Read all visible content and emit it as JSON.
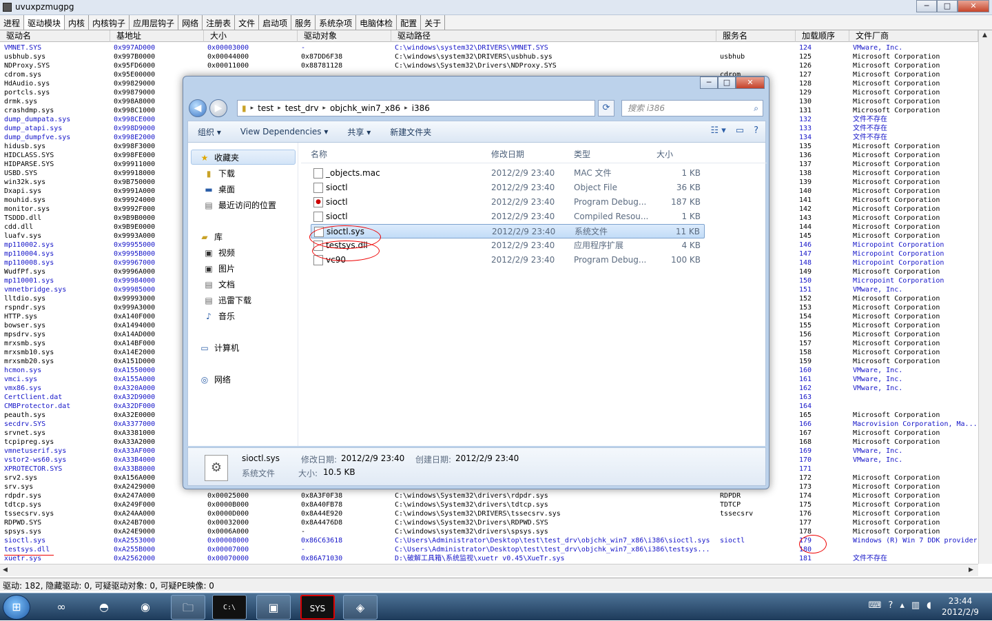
{
  "app": {
    "title": "uvuxpzmugpg",
    "controls": [
      "─",
      "□",
      "✕"
    ]
  },
  "tabs": [
    "进程",
    "驱动模块",
    "内核",
    "内核钩子",
    "应用层钩子",
    "网络",
    "注册表",
    "文件",
    "启动项",
    "服务",
    "系统杂项",
    "电脑体检",
    "配置",
    "关于"
  ],
  "table": {
    "columns": [
      "驱动名",
      "基地址",
      "大小",
      "驱动对象",
      "驱动路径",
      "服务名",
      "加载顺序",
      "文件厂商"
    ],
    "rows": [
      {
        "c": [
          "VMNET.SYS",
          "0x997AD000",
          "0x00003000",
          "-",
          "C:\\windows\\system32\\DRIVERS\\VMNET.SYS",
          "",
          "124",
          "VMware, Inc."
        ],
        "blue": true
      },
      {
        "c": [
          "usbhub.sys",
          "0x997B0000",
          "0x00044000",
          "0x87DD6F38",
          "C:\\windows\\system32\\DRIVERS\\usbhub.sys",
          "usbhub",
          "125",
          "Microsoft Corporation"
        ]
      },
      {
        "c": [
          "NDProxy.SYS",
          "0x95FD6000",
          "0x00011000",
          "0x88781128",
          "C:\\windows\\System32\\Drivers\\NDProxy.SYS",
          "",
          "126",
          "Microsoft Corporation"
        ]
      },
      {
        "c": [
          "cdrom.sys",
          "0x95E00000",
          "",
          "",
          "",
          "cdrom",
          "127",
          "Microsoft Corporation"
        ]
      },
      {
        "c": [
          "HdAudio.sys",
          "0x99829000",
          "",
          "",
          "",
          "",
          "128",
          "Microsoft Corporation"
        ]
      },
      {
        "c": [
          "portcls.sys",
          "0x99879000",
          "",
          "",
          "",
          "",
          "129",
          "Microsoft Corporation"
        ]
      },
      {
        "c": [
          "drmk.sys",
          "0x998A8000",
          "",
          "",
          "",
          "",
          "130",
          "Microsoft Corporation"
        ]
      },
      {
        "c": [
          "crashdmp.sys",
          "0x998C1000",
          "",
          "",
          "",
          "",
          "131",
          "Microsoft Corporation"
        ]
      },
      {
        "c": [
          "dump_dumpata.sys",
          "0x998CE000",
          "",
          "",
          "",
          "",
          "132",
          "文件不存在"
        ],
        "blue": true
      },
      {
        "c": [
          "dump_atapi.sys",
          "0x998D9000",
          "",
          "",
          "",
          "",
          "133",
          "文件不存在"
        ],
        "blue": true
      },
      {
        "c": [
          "dump_dumpfve.sys",
          "0x998E2000",
          "",
          "",
          "",
          "",
          "134",
          "文件不存在"
        ],
        "blue": true
      },
      {
        "c": [
          "hidusb.sys",
          "0x998F3000",
          "",
          "",
          "",
          "",
          "135",
          "Microsoft Corporation"
        ]
      },
      {
        "c": [
          "HIDCLASS.SYS",
          "0x998FE000",
          "",
          "",
          "",
          "",
          "136",
          "Microsoft Corporation"
        ]
      },
      {
        "c": [
          "HIDPARSE.SYS",
          "0x99911000",
          "",
          "",
          "",
          "",
          "137",
          "Microsoft Corporation"
        ]
      },
      {
        "c": [
          "USBD.SYS",
          "0x99918000",
          "",
          "",
          "",
          "",
          "138",
          "Microsoft Corporation"
        ]
      },
      {
        "c": [
          "win32k.sys",
          "0x9B750000",
          "",
          "",
          "",
          "",
          "139",
          "Microsoft Corporation"
        ]
      },
      {
        "c": [
          "Dxapi.sys",
          "0x9991A000",
          "",
          "",
          "",
          "",
          "140",
          "Microsoft Corporation"
        ]
      },
      {
        "c": [
          "mouhid.sys",
          "0x99924000",
          "",
          "",
          "",
          "",
          "141",
          "Microsoft Corporation"
        ]
      },
      {
        "c": [
          "monitor.sys",
          "0x9992F000",
          "",
          "",
          "",
          "",
          "142",
          "Microsoft Corporation"
        ]
      },
      {
        "c": [
          "TSDDD.dll",
          "0x9B9B0000",
          "",
          "",
          "",
          "",
          "143",
          "Microsoft Corporation"
        ]
      },
      {
        "c": [
          "cdd.dll",
          "0x9B9E0000",
          "",
          "",
          "",
          "",
          "144",
          "Microsoft Corporation"
        ]
      },
      {
        "c": [
          "luafv.sys",
          "0x9993A000",
          "",
          "",
          "",
          "",
          "145",
          "Microsoft Corporation"
        ]
      },
      {
        "c": [
          "mp110002.sys",
          "0x99955000",
          "",
          "",
          "",
          "",
          "146",
          "Micropoint Corporation"
        ],
        "blue": true
      },
      {
        "c": [
          "mp110004.sys",
          "0x9995B000",
          "",
          "",
          "",
          "",
          "147",
          "Micropoint Corporation"
        ],
        "blue": true
      },
      {
        "c": [
          "mp110008.sys",
          "0x99967000",
          "",
          "",
          "",
          "",
          "148",
          "Micropoint Corporation"
        ],
        "blue": true
      },
      {
        "c": [
          "WudfPf.sys",
          "0x9996A000",
          "",
          "",
          "",
          "",
          "149",
          "Microsoft Corporation"
        ]
      },
      {
        "c": [
          "mp110001.sys",
          "0x99984000",
          "",
          "",
          "",
          "",
          "150",
          "Micropoint Corporation"
        ],
        "blue": true
      },
      {
        "c": [
          "vmnetbridge.sys",
          "0x99985000",
          "",
          "",
          "",
          "",
          "151",
          "VMware, Inc."
        ],
        "blue": true
      },
      {
        "c": [
          "lltdio.sys",
          "0x99993000",
          "",
          "",
          "",
          "",
          "152",
          "Microsoft Corporation"
        ]
      },
      {
        "c": [
          "rspndr.sys",
          "0x999A3000",
          "",
          "",
          "",
          "",
          "153",
          "Microsoft Corporation"
        ]
      },
      {
        "c": [
          "HTTP.sys",
          "0xA140F000",
          "",
          "",
          "",
          "",
          "154",
          "Microsoft Corporation"
        ]
      },
      {
        "c": [
          "bowser.sys",
          "0xA1494000",
          "",
          "",
          "",
          "",
          "155",
          "Microsoft Corporation"
        ]
      },
      {
        "c": [
          "mpsdrv.sys",
          "0xA14AD000",
          "",
          "",
          "",
          "",
          "156",
          "Microsoft Corporation"
        ]
      },
      {
        "c": [
          "mrxsmb.sys",
          "0xA14BF000",
          "",
          "",
          "",
          "",
          "157",
          "Microsoft Corporation"
        ]
      },
      {
        "c": [
          "mrxsmb10.sys",
          "0xA14E2000",
          "",
          "",
          "",
          "",
          "158",
          "Microsoft Corporation"
        ]
      },
      {
        "c": [
          "mrxsmb20.sys",
          "0xA151D000",
          "",
          "",
          "",
          "",
          "159",
          "Microsoft Corporation"
        ]
      },
      {
        "c": [
          "hcmon.sys",
          "0xA1550000",
          "",
          "",
          "",
          "",
          "160",
          "VMware, Inc."
        ],
        "blue": true
      },
      {
        "c": [
          "vmci.sys",
          "0xA155A000",
          "",
          "",
          "",
          "",
          "161",
          "VMware, Inc."
        ],
        "blue": true
      },
      {
        "c": [
          "vmx86.sys",
          "0xA320A000",
          "",
          "",
          "",
          "",
          "162",
          "VMware, Inc."
        ],
        "blue": true
      },
      {
        "c": [
          "CertClient.dat",
          "0xA32D9000",
          "",
          "",
          "",
          "",
          "163",
          ""
        ],
        "blue": true
      },
      {
        "c": [
          "CMBProtector.dat",
          "0xA32DF000",
          "",
          "",
          "",
          "",
          "164",
          ""
        ],
        "blue": true
      },
      {
        "c": [
          "peauth.sys",
          "0xA32E0000",
          "",
          "",
          "",
          "",
          "165",
          "Microsoft Corporation"
        ]
      },
      {
        "c": [
          "secdrv.SYS",
          "0xA3377000",
          "",
          "",
          "",
          "",
          "166",
          "Macrovision Corporation, Ma..."
        ],
        "blue": true
      },
      {
        "c": [
          "srvnet.sys",
          "0xA3381000",
          "",
          "",
          "",
          "",
          "167",
          "Microsoft Corporation"
        ]
      },
      {
        "c": [
          "tcpipreg.sys",
          "0xA33A2000",
          "",
          "",
          "",
          "",
          "168",
          "Microsoft Corporation"
        ]
      },
      {
        "c": [
          "vmnetuserif.sys",
          "0xA33AF000",
          "",
          "",
          "",
          "",
          "169",
          "VMware, Inc."
        ],
        "blue": true
      },
      {
        "c": [
          "vstor2-ws60.sys",
          "0xA33B4000",
          "",
          "",
          "",
          "",
          "170",
          "VMware, Inc."
        ],
        "blue": true
      },
      {
        "c": [
          "XPROTECTOR.SYS",
          "0xA33B8000",
          "",
          "",
          "",
          "",
          "171",
          ""
        ],
        "blue": true
      },
      {
        "c": [
          "srv2.sys",
          "0xA156A000",
          "",
          "",
          "",
          "",
          "172",
          "Microsoft Corporation"
        ]
      },
      {
        "c": [
          "srv.sys",
          "0xA2429000",
          "",
          "",
          "",
          "",
          "173",
          "Microsoft Corporation"
        ]
      },
      {
        "c": [
          "rdpdr.sys",
          "0xA247A000",
          "0x00025000",
          "0x8A3F0F38",
          "C:\\windows\\System32\\drivers\\rdpdr.sys",
          "RDPDR",
          "174",
          "Microsoft Corporation"
        ]
      },
      {
        "c": [
          "tdtcp.sys",
          "0xA249F000",
          "0x0000B000",
          "0x8A40FB78",
          "C:\\windows\\System32\\drivers\\tdtcp.sys",
          "TDTCP",
          "175",
          "Microsoft Corporation"
        ]
      },
      {
        "c": [
          "tssecsrv.sys",
          "0xA24AA000",
          "0x0000D000",
          "0x8A44E920",
          "C:\\windows\\System32\\DRIVERS\\tssecsrv.sys",
          "tssecsrv",
          "176",
          "Microsoft Corporation"
        ]
      },
      {
        "c": [
          "RDPWD.SYS",
          "0xA24B7000",
          "0x00032000",
          "0x8A4476D8",
          "C:\\windows\\System32\\Drivers\\RDPWD.SYS",
          "",
          "177",
          "Microsoft Corporation"
        ]
      },
      {
        "c": [
          "spsys.sys",
          "0xA24E9000",
          "0x0006A000",
          "-",
          "C:\\windows\\system32\\drivers\\spsys.sys",
          "",
          "178",
          "Microsoft Corporation"
        ]
      },
      {
        "c": [
          "sioctl.sys",
          "0xA2553000",
          "0x00008000",
          "0x86C63618",
          "C:\\Users\\Administrator\\Desktop\\test\\test_drv\\objchk_win7_x86\\i386\\sioctl.sys",
          "sioctl",
          "179",
          "Windows (R) Win 7 DDK provider"
        ],
        "blue": true
      },
      {
        "c": [
          "testsys.dll",
          "0xA255B000",
          "0x00007000",
          "-",
          "C:\\Users\\Administrator\\Desktop\\test\\test_drv\\objchk_win7_x86\\i386\\testsys...",
          "",
          "180",
          ""
        ],
        "blue": true
      },
      {
        "c": [
          "xuetr.sys",
          "0xA2562000",
          "0x00070000",
          "0x86A71030",
          "D:\\破解工具箱\\系统监视\\xuetr v0.45\\XueTr.sys",
          "",
          "181",
          "文件不存在"
        ],
        "blue": true
      }
    ]
  },
  "status": {
    "text": "驱动: 182, 隐藏驱动: 0, 可疑驱动对象: 0, 可疑PE映像: 0"
  },
  "explorer": {
    "caption_controls": [
      "─",
      "□",
      "✕"
    ],
    "breadcrumb": [
      "test",
      "test_drv",
      "objchk_win7_x86",
      "i386"
    ],
    "search_placeholder": "搜索 i386",
    "commands": [
      "组织 ▾",
      "View Dependencies ▾",
      "共享 ▾",
      "新建文件夹"
    ],
    "nav": {
      "favorites": "收藏夹",
      "downloads": "下载",
      "desktop": "桌面",
      "recent": "最近访问的位置",
      "library": "库",
      "video": "视频",
      "pictures": "图片",
      "docs": "文档",
      "thunder": "迅雷下载",
      "music": "音乐",
      "computer": "计算机",
      "network": "网络"
    },
    "columns": [
      "名称",
      "修改日期",
      "类型",
      "大小"
    ],
    "files": [
      {
        "name": "_objects.mac",
        "date": "2012/2/9 23:40",
        "type": "MAC 文件",
        "size": "1 KB"
      },
      {
        "name": "sioctl",
        "date": "2012/2/9 23:40",
        "type": "Object File",
        "size": "36 KB"
      },
      {
        "name": "sioctl",
        "date": "2012/2/9 23:40",
        "type": "Program Debug...",
        "size": "187 KB",
        "blue": true
      },
      {
        "name": "sioctl",
        "date": "2012/2/9 23:40",
        "type": "Compiled Resou...",
        "size": "1 KB"
      },
      {
        "name": "sioctl.sys",
        "date": "2012/2/9 23:40",
        "type": "系统文件",
        "size": "11 KB",
        "selected": true
      },
      {
        "name": "testsys.dll",
        "date": "2012/2/9 23:40",
        "type": "应用程序扩展",
        "size": "4 KB"
      },
      {
        "name": "vc90",
        "date": "2012/2/9 23:40",
        "type": "Program Debug...",
        "size": "100 KB"
      }
    ],
    "details": {
      "name": "sioctl.sys",
      "modified_label": "修改日期:",
      "modified": "2012/2/9 23:40",
      "created_label": "创建日期:",
      "created": "2012/2/9 23:40",
      "type": "系统文件",
      "size_label": "大小:",
      "size": "10.5 KB"
    }
  },
  "taskbar": {
    "start": "⊞",
    "buttons": [
      "∞",
      "◓",
      "◉",
      "🗀",
      "C:\\",
      "▣",
      "SYS",
      "◈"
    ],
    "time": "23:44",
    "date": "2012/2/9"
  },
  "colors": {
    "accent_blue": "#1414c8",
    "annotation_red": "#e00000"
  }
}
